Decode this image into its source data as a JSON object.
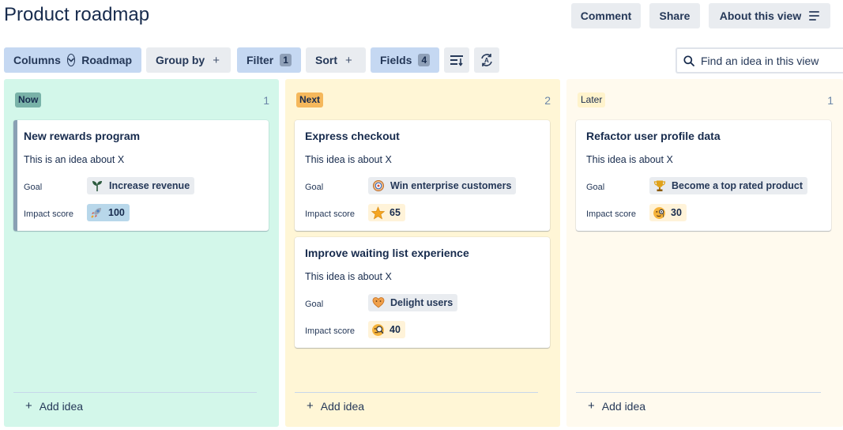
{
  "header": {
    "title": "Product roadmap",
    "comment_label": "Comment",
    "share_label": "Share",
    "about_label": "About this view"
  },
  "toolbar": {
    "columns_label": "Columns",
    "columns_value": "Roadmap",
    "group_by_label": "Group by",
    "filter_label": "Filter",
    "filter_count": "1",
    "sort_label": "Sort",
    "fields_label": "Fields",
    "fields_count": "4",
    "plus_glyph": "+"
  },
  "search": {
    "placeholder": "Find an idea in this view"
  },
  "columns": [
    {
      "label": "Now",
      "count": "1",
      "add_label": "Add idea",
      "cards": [
        {
          "title": "New rewards program",
          "description": "This is an idea about X",
          "goal_label": "Goal",
          "goal": "Increase revenue",
          "goal_icon": "seedling-icon",
          "impact_label": "Impact score",
          "impact": "100",
          "impact_icon": "rocket-icon"
        }
      ]
    },
    {
      "label": "Next",
      "count": "2",
      "add_label": "Add idea",
      "cards": [
        {
          "title": "Express checkout",
          "description": "This idea is about X",
          "goal_label": "Goal",
          "goal": "Win enterprise customers",
          "goal_icon": "target-icon",
          "impact_label": "Impact score",
          "impact": "65",
          "impact_icon": "star-icon"
        },
        {
          "title": "Improve waiting list experience",
          "description": "This idea is about X",
          "goal_label": "Goal",
          "goal": "Delight users",
          "goal_icon": "heart-icon",
          "impact_label": "Impact score",
          "impact": "40",
          "impact_icon": "magnifier-face-icon"
        }
      ]
    },
    {
      "label": "Later",
      "count": "1",
      "add_label": "Add idea",
      "cards": [
        {
          "title": "Refactor user profile data",
          "description": "This idea is about X",
          "goal_label": "Goal",
          "goal": "Become a top rated product",
          "goal_icon": "trophy-icon",
          "impact_label": "Impact score",
          "impact": "30",
          "impact_icon": "monocle-face-icon"
        }
      ]
    }
  ]
}
